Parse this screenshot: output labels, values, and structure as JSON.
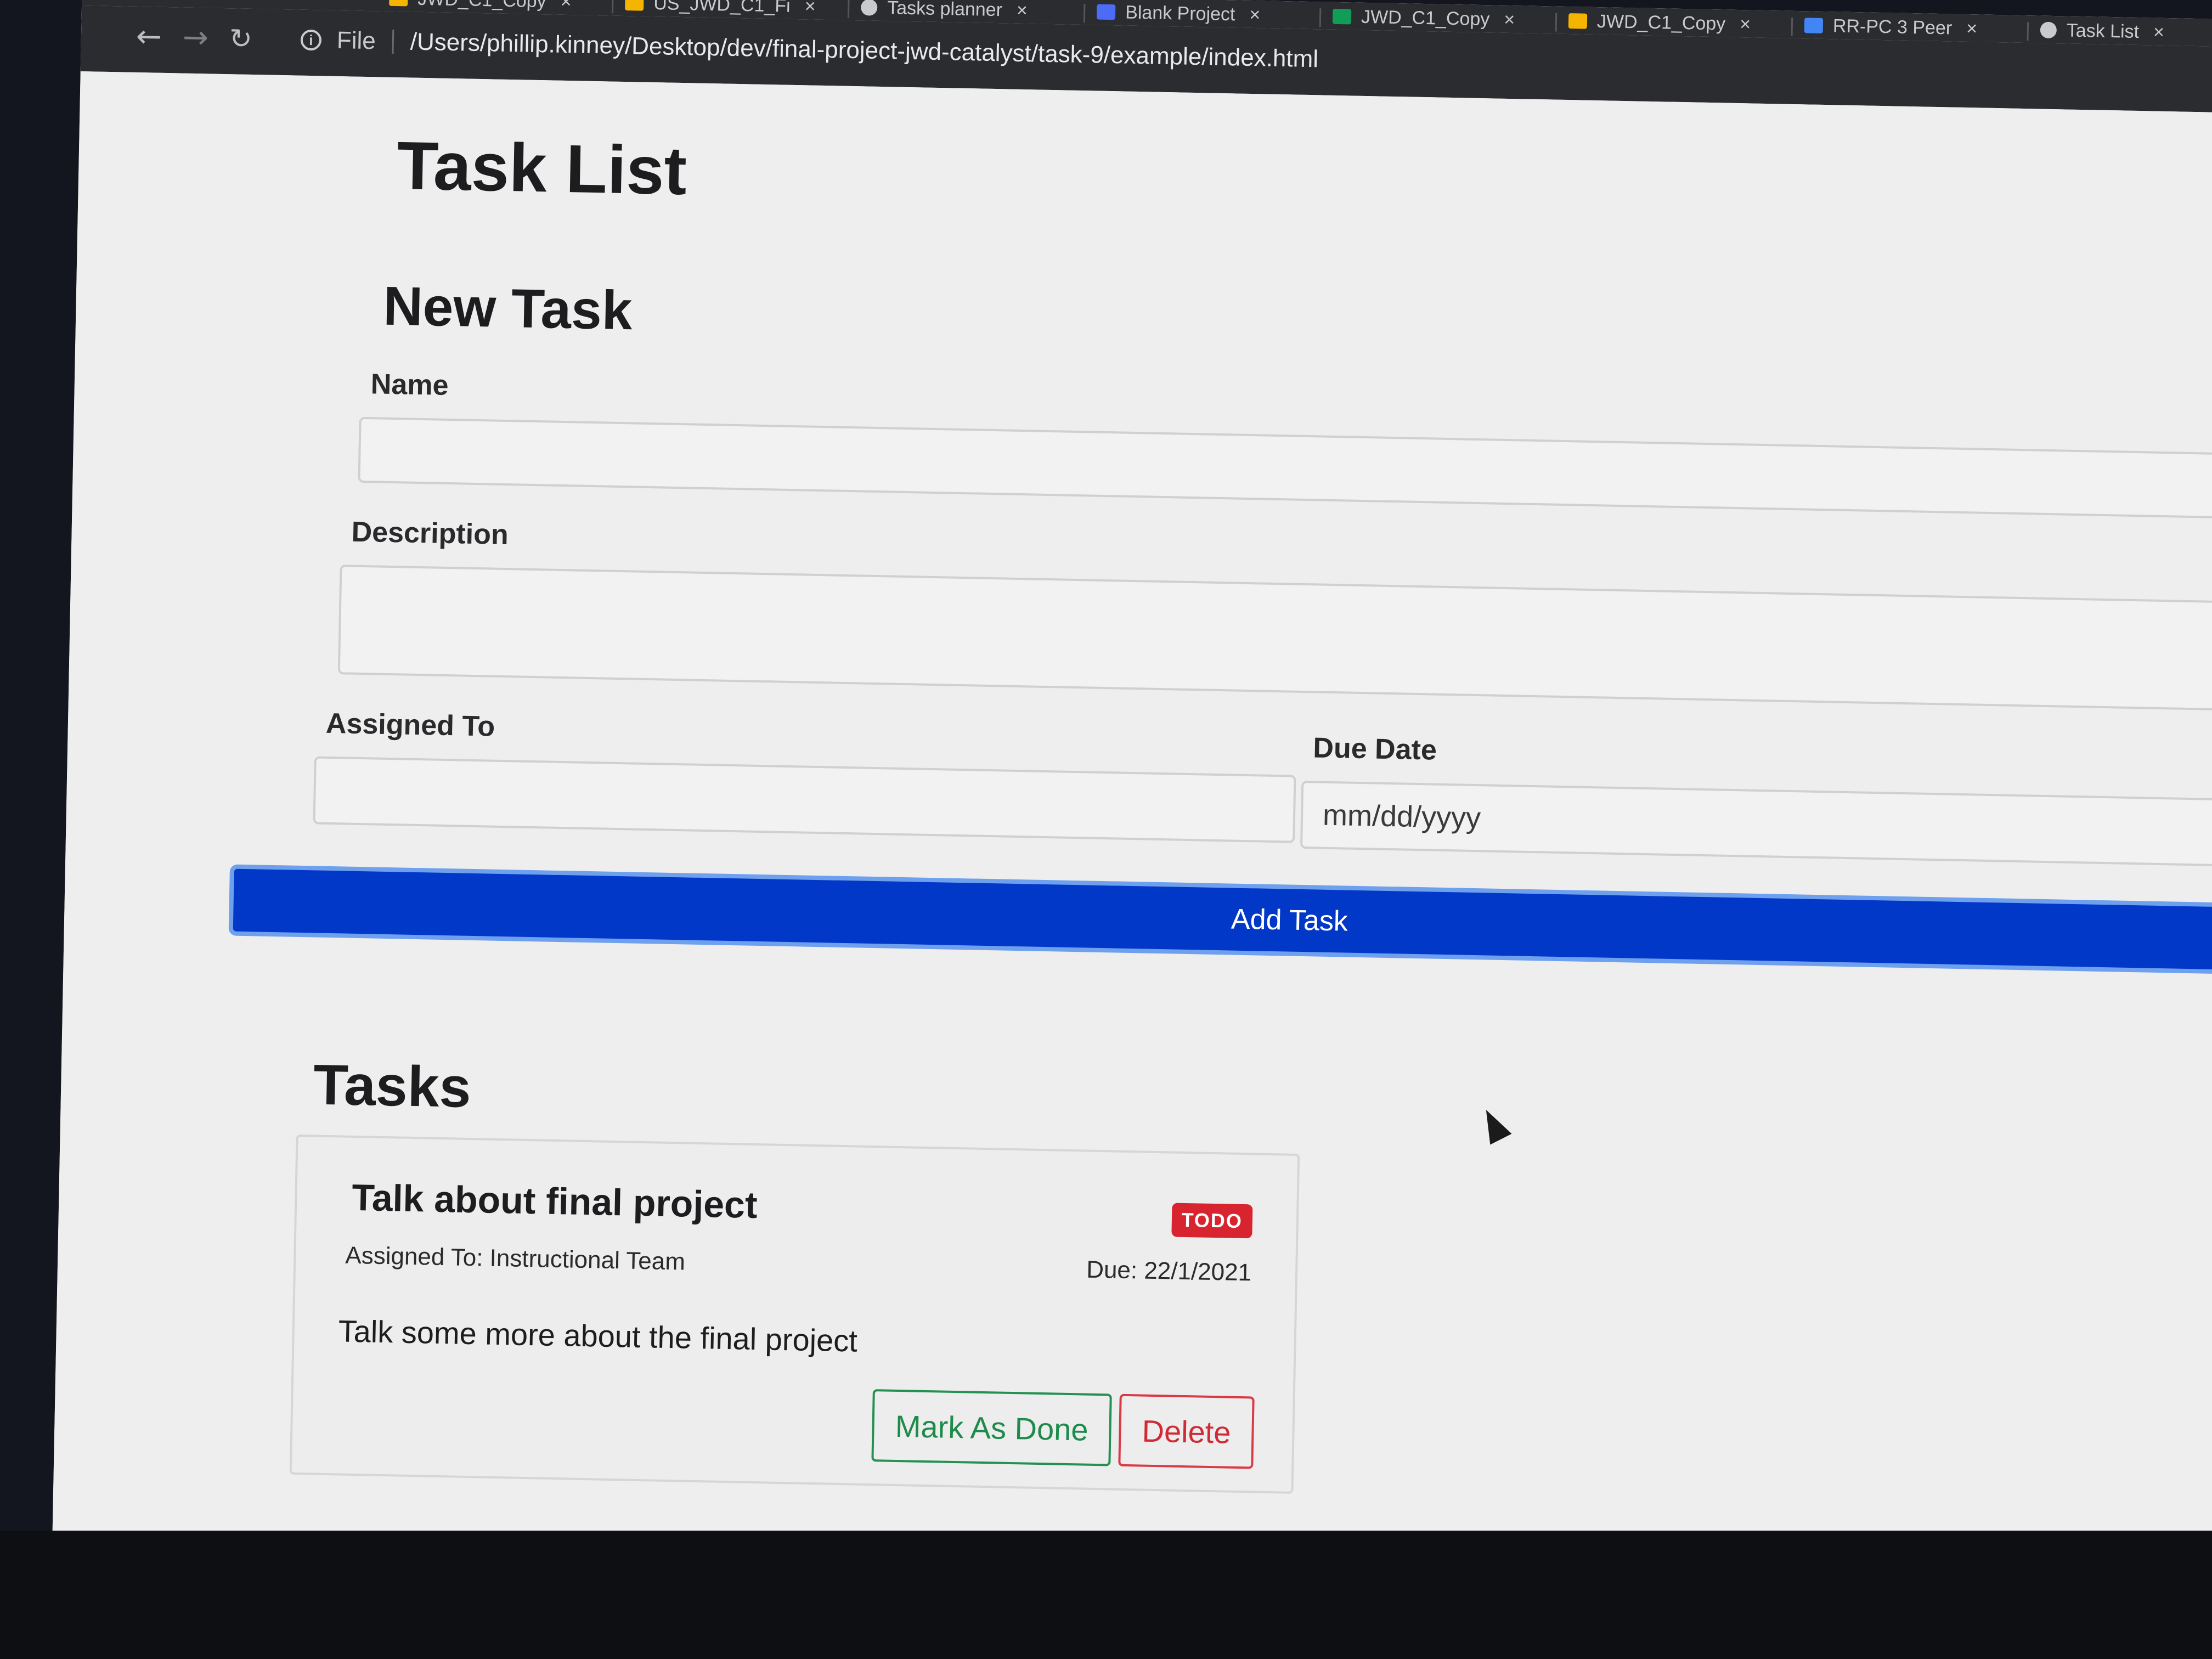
{
  "browser": {
    "tabs": [
      {
        "label": "JWD_C1_Copy",
        "icon": "slides-icon",
        "icon_color": "#f4b400"
      },
      {
        "label": "US_JWD_C1_Fi",
        "icon": "slides-icon",
        "icon_color": "#f4b400"
      },
      {
        "label": "Tasks planner",
        "icon": "globe-icon",
        "icon_color": "#c9cacd"
      },
      {
        "label": "Blank Project",
        "icon": "m-app-icon",
        "icon_color": "#4a6cf7"
      },
      {
        "label": "JWD_C1_Copy",
        "icon": "sheets-icon",
        "icon_color": "#0f9d58"
      },
      {
        "label": "JWD_C1_Copy",
        "icon": "slides-icon",
        "icon_color": "#f4b400"
      },
      {
        "label": "RR-PC 3 Peer",
        "icon": "docs-icon",
        "icon_color": "#4285f4"
      },
      {
        "label": "Task List",
        "icon": "globe-icon",
        "icon_color": "#c9cacd"
      }
    ],
    "close_glyph": "×",
    "omnibox": {
      "scheme_label": "File",
      "url": "/Users/phillip.kinney/Desktop/dev/final-project-jwd-catalyst/task-9/example/index.html"
    }
  },
  "page": {
    "title": "Task List",
    "form": {
      "heading": "New Task",
      "name_label": "Name",
      "name_value": "",
      "description_label": "Description",
      "description_value": "",
      "assigned_label": "Assigned To",
      "assigned_value": "",
      "due_label": "Due Date",
      "due_placeholder": "mm/dd/yyyy",
      "submit_label": "Add Task",
      "submit_color": "#0138c7"
    },
    "tasks_heading": "Tasks",
    "tasks": [
      {
        "name": "Talk about final project",
        "status": "TODO",
        "status_color": "#d8242f",
        "assigned": "Assigned To: Instructional Team",
        "due": "Due: 22/1/2021",
        "description": "Talk some more about the final project",
        "done_label": "Mark As Done",
        "delete_label": "Delete"
      }
    ]
  }
}
